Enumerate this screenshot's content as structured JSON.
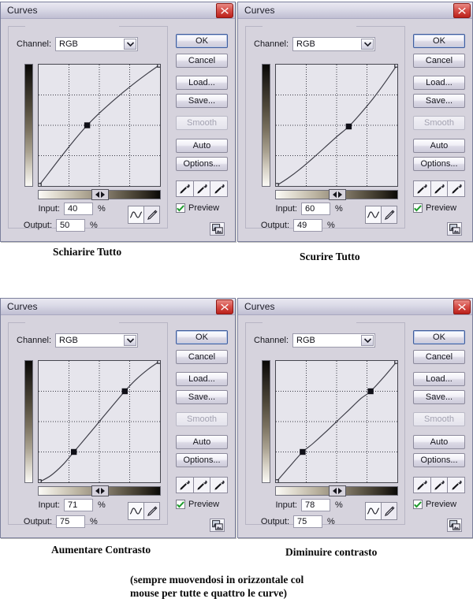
{
  "dialogs": [
    {
      "key": "lighten",
      "title": "Curves",
      "channel_label": "Channel:",
      "channel_value": "RGB",
      "input_label": "Input:",
      "input_value": "40",
      "output_label": "Output:",
      "output_value": "50",
      "percent": "%",
      "preview_label": "Preview",
      "buttons": {
        "ok": "OK",
        "cancel": "Cancel",
        "load": "Load...",
        "save": "Save...",
        "smooth": "Smooth",
        "auto": "Auto",
        "options": "Options..."
      },
      "caption": "Schiarire Tutto"
    },
    {
      "key": "darken",
      "title": "Curves",
      "channel_label": "Channel:",
      "channel_value": "RGB",
      "input_label": "Input:",
      "input_value": "60",
      "output_label": "Output:",
      "output_value": "49",
      "percent": "%",
      "preview_label": "Preview",
      "buttons": {
        "ok": "OK",
        "cancel": "Cancel",
        "load": "Load...",
        "save": "Save...",
        "smooth": "Smooth",
        "auto": "Auto",
        "options": "Options..."
      },
      "caption": "Scurire Tutto"
    },
    {
      "key": "more-contrast",
      "title": "Curves",
      "channel_label": "Channel:",
      "channel_value": "RGB",
      "input_label": "Input:",
      "input_value": "71",
      "output_label": "Output:",
      "output_value": "75",
      "percent": "%",
      "preview_label": "Preview",
      "buttons": {
        "ok": "OK",
        "cancel": "Cancel",
        "load": "Load...",
        "save": "Save...",
        "smooth": "Smooth",
        "auto": "Auto",
        "options": "Options..."
      },
      "caption": "Aumentare Contrasto"
    },
    {
      "key": "less-contrast",
      "title": "Curves",
      "channel_label": "Channel:",
      "channel_value": "RGB",
      "input_label": "Input:",
      "input_value": "78",
      "output_label": "Output:",
      "output_value": "75",
      "percent": "%",
      "preview_label": "Preview",
      "buttons": {
        "ok": "OK",
        "cancel": "Cancel",
        "load": "Load...",
        "save": "Save...",
        "smooth": "Smooth",
        "auto": "Auto",
        "options": "Options..."
      },
      "caption": "Diminuire contrasto"
    }
  ],
  "footnote_line1": "(sempre muovendosi in orizzontale col",
  "footnote_line2": "mouse per tutte e quattro le curve)",
  "icons": {
    "close": "close-icon",
    "chevron_down": "chevron-down-icon",
    "curve_tool": "curve-tool-icon",
    "pencil_tool": "pencil-tool-icon",
    "eyedropper": "eyedropper-icon",
    "check": "check-icon",
    "preview_thumb": "preview-thumbnail-icon",
    "slider": "slider-arrows-icon"
  },
  "colors": {
    "dialog_bg": "#d6d3dd",
    "graph_bg": "#e6e5ec",
    "default_btn_border": "#3f5c9c",
    "close_btn": "#bb211b",
    "check_green": "#1f9b2e"
  },
  "chart_data": [
    {
      "type": "line",
      "title": "Schiarire Tutto",
      "xlabel": "Input",
      "ylabel": "Output",
      "xlim": [
        0,
        100
      ],
      "ylim": [
        0,
        100
      ],
      "grid": true,
      "grid_divisions": 4,
      "control_points": [
        [
          0,
          0
        ],
        [
          40,
          50
        ],
        [
          100,
          100
        ]
      ],
      "series": [
        {
          "name": "RGB",
          "x": [
            0,
            10,
            20,
            30,
            40,
            50,
            60,
            70,
            80,
            90,
            100
          ],
          "y": [
            0,
            13,
            26,
            38.5,
            50,
            60,
            69,
            77.5,
            85.5,
            93,
            100
          ]
        }
      ],
      "input": 40,
      "output": 50
    },
    {
      "type": "line",
      "title": "Scurire Tutto",
      "xlabel": "Input",
      "ylabel": "Output",
      "xlim": [
        0,
        100
      ],
      "ylim": [
        0,
        100
      ],
      "grid": true,
      "grid_divisions": 4,
      "control_points": [
        [
          0,
          0
        ],
        [
          60,
          49
        ],
        [
          100,
          100
        ]
      ],
      "series": [
        {
          "name": "RGB",
          "x": [
            0,
            10,
            20,
            30,
            40,
            50,
            60,
            70,
            80,
            90,
            100
          ],
          "y": [
            0,
            6.5,
            14,
            22.5,
            31.5,
            40.5,
            49,
            60,
            72,
            85.5,
            100
          ]
        }
      ],
      "input": 60,
      "output": 49
    },
    {
      "type": "line",
      "title": "Aumentare Contrasto",
      "xlabel": "Input",
      "ylabel": "Output",
      "xlim": [
        0,
        100
      ],
      "ylim": [
        0,
        100
      ],
      "grid": true,
      "grid_divisions": 4,
      "control_points": [
        [
          0,
          0
        ],
        [
          29,
          25
        ],
        [
          71,
          75
        ],
        [
          100,
          100
        ]
      ],
      "series": [
        {
          "name": "RGB",
          "x": [
            0,
            10,
            20,
            29,
            40,
            50,
            60,
            71,
            80,
            90,
            100
          ],
          "y": [
            0,
            5.5,
            14.5,
            25,
            38,
            50,
            62,
            75,
            84.5,
            93,
            100
          ]
        }
      ],
      "input": 71,
      "output": 75
    },
    {
      "type": "line",
      "title": "Diminuire contrasto",
      "xlabel": "Input",
      "ylabel": "Output",
      "xlim": [
        0,
        100
      ],
      "ylim": [
        0,
        100
      ],
      "grid": true,
      "grid_divisions": 4,
      "control_points": [
        [
          0,
          0
        ],
        [
          22,
          25
        ],
        [
          78,
          75
        ],
        [
          100,
          100
        ]
      ],
      "series": [
        {
          "name": "RGB",
          "x": [
            0,
            10,
            22,
            30,
            40,
            50,
            60,
            70,
            78,
            90,
            100
          ],
          "y": [
            0,
            11.5,
            25,
            31.5,
            40.5,
            50,
            59.5,
            69,
            75,
            88,
            100
          ]
        }
      ],
      "input": 78,
      "output": 75
    }
  ]
}
